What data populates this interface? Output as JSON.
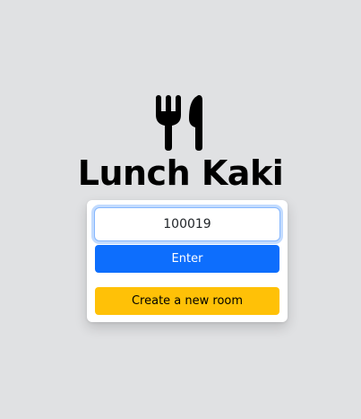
{
  "app": {
    "title": "Lunch Kaki",
    "logo_icon": "fork-and-knife-icon"
  },
  "room_form": {
    "room_code_value": "100019",
    "enter_label": "Enter",
    "create_label": "Create a new room"
  },
  "colors": {
    "background": "#e0e1e3",
    "primary": "#0d6efd",
    "warning": "#ffc107",
    "focus_border": "#86b7fe"
  }
}
